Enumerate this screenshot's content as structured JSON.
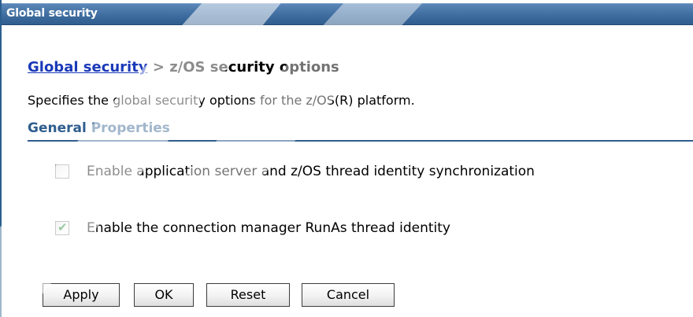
{
  "window": {
    "title": "Global security"
  },
  "breadcrumb": {
    "parent_link": "Global security",
    "separator": " > ",
    "current": "z/OS security options"
  },
  "description": "Specifies the global security options for the z/OS(R) platform.",
  "section": {
    "title": "General Properties"
  },
  "options": [
    {
      "label": "Enable application server and z/OS thread identity synchronization",
      "checked": false
    },
    {
      "label": "Enable the connection manager RunAs thread identity",
      "checked": true
    }
  ],
  "checkmark_glyph": "✔",
  "buttons": {
    "apply": "Apply",
    "ok": "OK",
    "reset": "Reset",
    "cancel": "Cancel"
  },
  "colors": {
    "titlebar": "#3f6d9f",
    "link": "#1a3ab8",
    "section_header": "#2f5d8e",
    "checkmark": "#1f8a3a"
  }
}
